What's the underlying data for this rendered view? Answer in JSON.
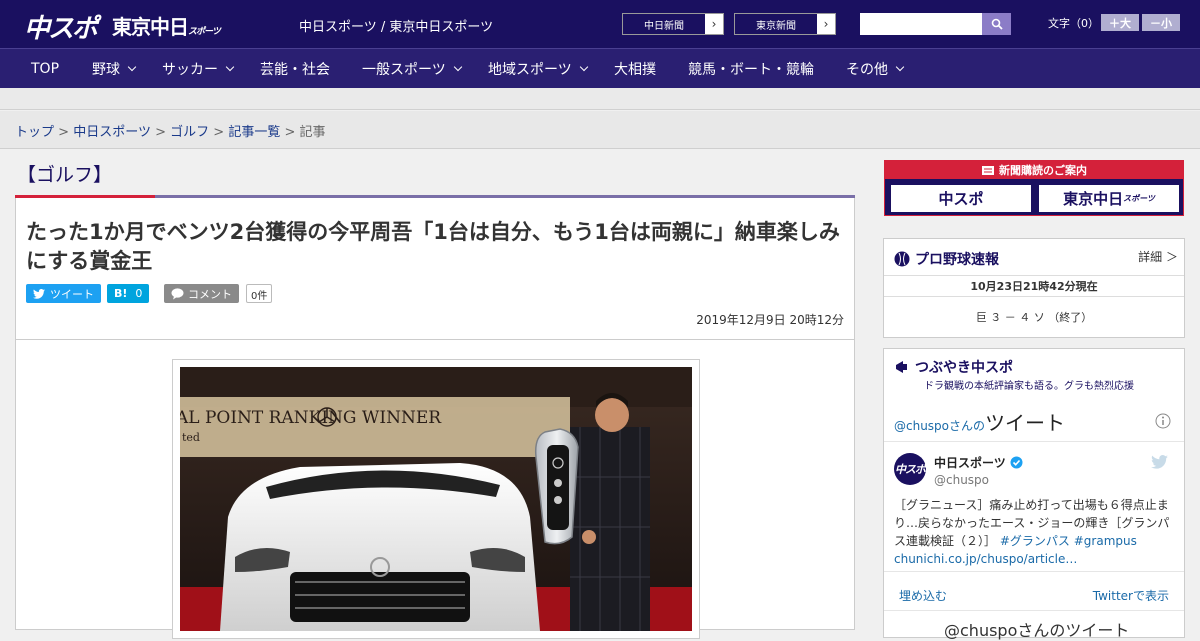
{
  "header": {
    "logo_primary": "中スポ",
    "logo_secondary": "東京中日",
    "logo_secondary_small": "スポーツ",
    "site_name": "中日スポーツ / 東京中日スポーツ",
    "paper_links": [
      {
        "label": "中日新聞"
      },
      {
        "label": "東京新聞"
      }
    ],
    "search_placeholder": "",
    "font_size_label": "文字（0）",
    "font_up": "＋大",
    "font_down": "－小"
  },
  "nav": {
    "items": [
      {
        "label": "TOP"
      },
      {
        "label": "野球"
      },
      {
        "label": "サッカー"
      },
      {
        "label": "芸能・社会"
      },
      {
        "label": "一般スポーツ"
      },
      {
        "label": "地域スポーツ"
      },
      {
        "label": "大相撲"
      },
      {
        "label": "競馬・ボート・競輪"
      },
      {
        "label": "その他"
      }
    ]
  },
  "breadcrumb": {
    "items": [
      "トップ",
      "中日スポーツ",
      "ゴルフ",
      "記事一覧"
    ],
    "separator": ">",
    "current": "記事"
  },
  "article": {
    "category": "【ゴルフ】",
    "title": "たった1か月でベンツ2台獲得の今平周吾「1台は自分、もう1台は両親に」納車楽しみにする賞金王",
    "tweet_label": "ツイート",
    "hatena_label": "B!",
    "hatena_count": "0",
    "comment_label": "コメント",
    "comment_count": "0件",
    "date": "2019年12月9日 20時12分",
    "photo_backdrop_text": "AL POINT RANKING WINNER",
    "photo_backdrop_text2": "ted"
  },
  "sidebar": {
    "subscribe": {
      "header": "新聞購読のご案内",
      "logo1": "中スポ",
      "logo2": "東京中日",
      "logo2_small": "スポーツ"
    },
    "baseball": {
      "title": "プロ野球速報",
      "detail": "詳細 ＞",
      "time": "10月23日21時42分現在",
      "score": "巨 ３ － ４ ソ （終了）"
    },
    "tsubuyaki": {
      "title": "つぶやき中スポ",
      "subtitle": "ドラ観戦の本紙評論家も語る。グラも熱烈応援"
    },
    "twitter": {
      "heading_prefix": "@chuspoさんの",
      "heading": "ツイート",
      "account_name": "中日スポーツ",
      "handle": "@chuspo",
      "tweet_text": "［グラニュース］痛み止め打って出場も６得点止まり…戻らなかったエース・ジョーの輝き［グランパス連載検証（２）］",
      "hashtag1": "#グランパス",
      "hashtag2": "#grampus",
      "link": "chunichi.co.jp/chuspo/article…",
      "embed": "埋め込む",
      "view_on_twitter": "Twitterで表示",
      "footer": "@chuspoさんのツイート"
    }
  },
  "colors": {
    "brand": "#1a1060",
    "nav": "#2a1f72",
    "accent_red": "#d4213a",
    "twitter": "#1da1f2",
    "hatena": "#00a4de"
  }
}
